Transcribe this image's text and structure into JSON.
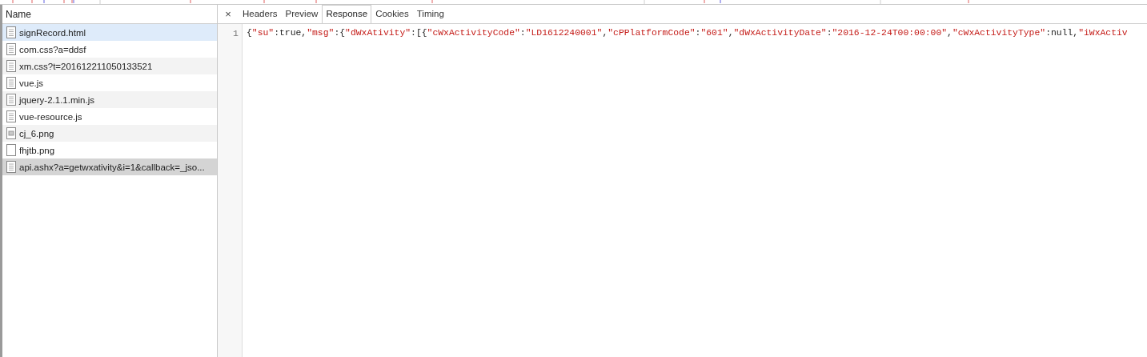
{
  "requests": {
    "column": "Name",
    "rows": [
      {
        "name": "signRecord.html",
        "kind": "document",
        "hovered": true,
        "selected": false
      },
      {
        "name": "com.css?a=ddsf",
        "kind": "document",
        "hovered": false,
        "selected": false
      },
      {
        "name": "xm.css?t=201612211050133521",
        "kind": "document",
        "hovered": false,
        "selected": false
      },
      {
        "name": "vue.js",
        "kind": "document",
        "hovered": false,
        "selected": false
      },
      {
        "name": "jquery-2.1.1.min.js",
        "kind": "document",
        "hovered": false,
        "selected": false
      },
      {
        "name": "vue-resource.js",
        "kind": "document",
        "hovered": false,
        "selected": false
      },
      {
        "name": "cj_6.png",
        "kind": "image",
        "hovered": false,
        "selected": false
      },
      {
        "name": "fhjtb.png",
        "kind": "blank",
        "hovered": false,
        "selected": false
      },
      {
        "name": "api.ashx?a=getwxativity&i=1&callback=_jso...",
        "kind": "document",
        "hovered": false,
        "selected": true
      }
    ]
  },
  "detail": {
    "close": "×",
    "tabs": [
      {
        "label": "Headers",
        "selected": false
      },
      {
        "label": "Preview",
        "selected": false
      },
      {
        "label": "Response",
        "selected": true
      },
      {
        "label": "Cookies",
        "selected": false
      },
      {
        "label": "Timing",
        "selected": false
      }
    ],
    "lines": [
      {
        "number": "1",
        "tokens": [
          {
            "kind": "punct",
            "text": "{"
          },
          {
            "kind": "string",
            "text": "\"su\""
          },
          {
            "kind": "punct",
            "text": ":true,"
          },
          {
            "kind": "string",
            "text": "\"msg\""
          },
          {
            "kind": "punct",
            "text": ":{"
          },
          {
            "kind": "string",
            "text": "\"dWxAtivity\""
          },
          {
            "kind": "punct",
            "text": ":[{"
          },
          {
            "kind": "string",
            "text": "\"cWxActivityCode\""
          },
          {
            "kind": "punct",
            "text": ":"
          },
          {
            "kind": "string",
            "text": "\"LD1612240001\""
          },
          {
            "kind": "punct",
            "text": ","
          },
          {
            "kind": "string",
            "text": "\"cPPlatformCode\""
          },
          {
            "kind": "punct",
            "text": ":"
          },
          {
            "kind": "string",
            "text": "\"601\""
          },
          {
            "kind": "punct",
            "text": ","
          },
          {
            "kind": "string",
            "text": "\"dWxActivityDate\""
          },
          {
            "kind": "punct",
            "text": ":"
          },
          {
            "kind": "string",
            "text": "\"2016-12-24T00:00:00\""
          },
          {
            "kind": "punct",
            "text": ","
          },
          {
            "kind": "string",
            "text": "\"cWxActivityType\""
          },
          {
            "kind": "punct",
            "text": ":null,"
          },
          {
            "kind": "string",
            "text": "\"iWxActiv"
          }
        ]
      }
    ]
  }
}
